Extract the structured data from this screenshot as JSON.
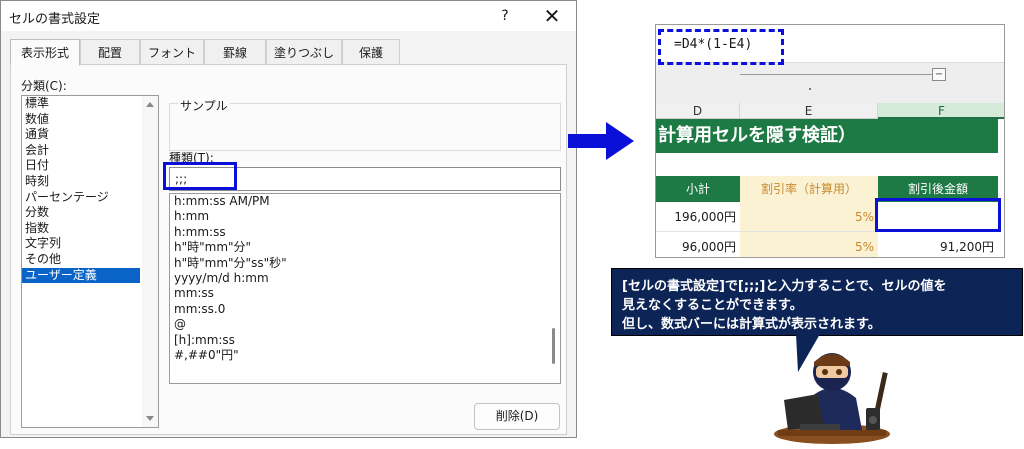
{
  "dialog": {
    "title": "セルの書式設定",
    "help_label": "?",
    "close_label": "✕",
    "tabs": [
      "表示形式",
      "配置",
      "フォント",
      "罫線",
      "塗りつぶし",
      "保護"
    ],
    "category_label": "分類(C):",
    "categories": [
      "標準",
      "数値",
      "通貨",
      "会計",
      "日付",
      "時刻",
      "パーセンテージ",
      "分数",
      "指数",
      "文字列",
      "その他",
      "ユーザー定義"
    ],
    "selected_category": "ユーザー定義",
    "sample_label": "サンプル",
    "type_label": "種類(T):",
    "type_value": ";;;",
    "format_list": [
      "h:mm:ss AM/PM",
      "h:mm",
      "h:mm:ss",
      "h\"時\"mm\"分\"",
      "h\"時\"mm\"分\"ss\"秒\"",
      "yyyy/m/d h:mm",
      "mm:ss",
      "mm:ss.0",
      "@",
      "[h]:mm:ss",
      "#,##0\"円\""
    ],
    "delete_button": "削除(D)"
  },
  "spreadsheet": {
    "formula": "=D4*(1-E4)",
    "zoom_minus": "−",
    "columns": [
      "D",
      "E",
      "F"
    ],
    "title_text": "計算用セルを隠す検証）",
    "headers": [
      "小計",
      "割引率（計算用）",
      "割引後金額"
    ],
    "rows": [
      [
        "196,000円",
        "5%",
        ""
      ],
      [
        "96,000円",
        "5%",
        "91,200円"
      ]
    ]
  },
  "callout": {
    "line1": "[セルの書式設定]で[;;;]と入力することで、セルの値を",
    "line2": "見えなくすることができます。",
    "line3": "但し、数式バーには計算式が表示されます。"
  },
  "colors": {
    "highlight": "#0a10d8",
    "excel_green": "#1e7a44",
    "callout_bg": "#0d2457",
    "rate_fill": "#fbf1d3"
  }
}
